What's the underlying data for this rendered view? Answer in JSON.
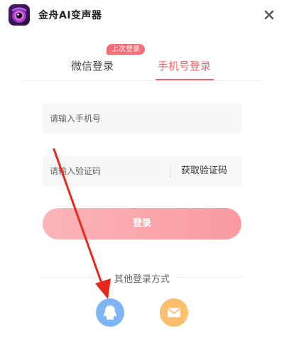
{
  "header": {
    "app_title": "金舟AI变声器",
    "logo_icon": "purple-eye-logo-icon",
    "close_icon": "close-icon"
  },
  "tabs": {
    "wechat_label": "微信登录",
    "phone_label": "手机号登录",
    "last_login_badge": "上次登录",
    "active": "phone"
  },
  "form": {
    "phone_placeholder": "请输入手机号",
    "phone_value": "",
    "code_placeholder": "请输入验证码",
    "code_value": "",
    "get_code_label": "获取验证码",
    "login_label": "登录"
  },
  "other_methods": {
    "label": "其他登录方式",
    "methods": [
      {
        "name": "qq",
        "icon": "qq-icon",
        "color": "#7fb4f5"
      },
      {
        "name": "email",
        "icon": "mail-icon",
        "color": "#fbbf6e"
      }
    ]
  },
  "colors": {
    "accent": "#f0646e",
    "login_gradient_start": "#fbb5b8",
    "login_gradient_end": "#f99aa0",
    "annotation": "#e8281e"
  }
}
